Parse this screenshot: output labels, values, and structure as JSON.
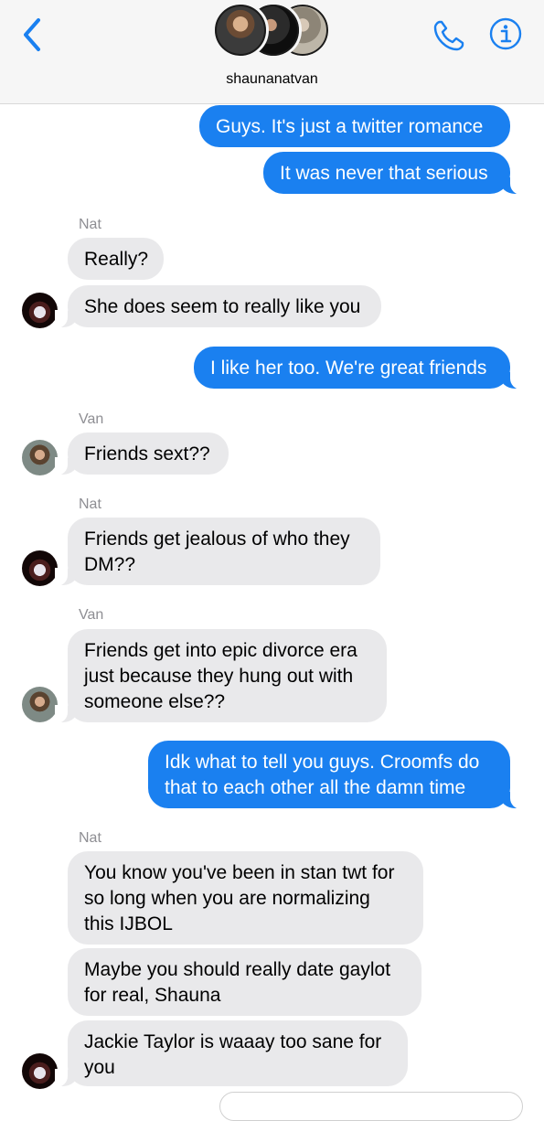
{
  "header": {
    "title": "shaunanatvan",
    "accent_color": "#1a80f0",
    "icons": {
      "back": "chevron-left-icon",
      "call": "phone-icon",
      "info": "info-icon"
    }
  },
  "messages": [
    {
      "id": "m1",
      "direction": "outgoing",
      "text": "Guys. It's just a twitter romance"
    },
    {
      "id": "m2",
      "direction": "outgoing",
      "text": "It was never that serious"
    },
    {
      "id": "s1",
      "sender_label": "Nat"
    },
    {
      "id": "m3",
      "direction": "incoming",
      "sender": "Nat",
      "text": "Really?"
    },
    {
      "id": "m4",
      "direction": "incoming",
      "sender": "Nat",
      "text": "She does seem to really like you"
    },
    {
      "id": "m5",
      "direction": "outgoing",
      "text": "I like her too. We're great friends"
    },
    {
      "id": "s2",
      "sender_label": "Van"
    },
    {
      "id": "m6",
      "direction": "incoming",
      "sender": "Van",
      "text": "Friends sext??"
    },
    {
      "id": "s3",
      "sender_label": "Nat"
    },
    {
      "id": "m7",
      "direction": "incoming",
      "sender": "Nat",
      "text": "Friends get jealous of who they\nDM??"
    },
    {
      "id": "s4",
      "sender_label": "Van"
    },
    {
      "id": "m8",
      "direction": "incoming",
      "sender": "Van",
      "text": "Friends get into epic divorce era\njust because they hung out with\nsomeone else??"
    },
    {
      "id": "m9",
      "direction": "outgoing",
      "text": "Idk what to tell you guys. Croomfs do\nthat to each other all the damn time"
    },
    {
      "id": "s5",
      "sender_label": "Nat"
    },
    {
      "id": "m10",
      "direction": "incoming",
      "sender": "Nat",
      "text": "You know you've been in stan twt for\nso long when you are normalizing\nthis IJBOL"
    },
    {
      "id": "m11",
      "direction": "incoming",
      "sender": "Nat",
      "text": "Maybe you should really date gaylot\nfor real, Shauna"
    },
    {
      "id": "m12",
      "direction": "incoming",
      "sender": "Nat",
      "text": "Jackie Taylor is waaay too sane for\nyou"
    }
  ],
  "colors": {
    "outgoing_bubble": "#1a80f0",
    "incoming_bubble": "#e9e9eb",
    "sender_label": "#8e8e93"
  }
}
